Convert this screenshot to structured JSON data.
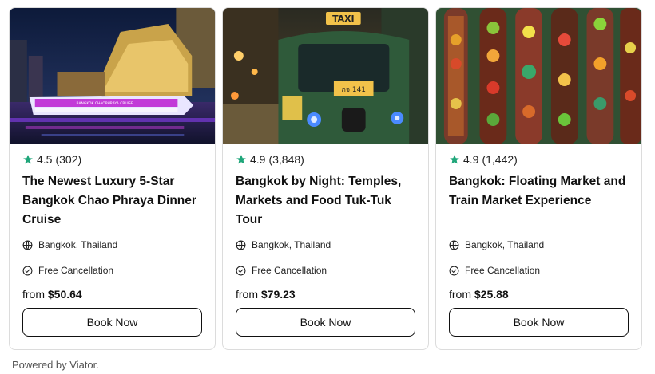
{
  "cards": [
    {
      "rating": "4.5",
      "reviews": "(302)",
      "title": "The Newest Luxury 5-Star Bangkok Chao Phraya Dinner Cruise",
      "location": "Bangkok, Thailand",
      "cancellation": "Free Cancellation",
      "price_prefix": "from",
      "price": "$50.64",
      "button_label": "Book Now",
      "photo_sign": "BANGKOK CHAOPHRAYA CRUISE"
    },
    {
      "rating": "4.9",
      "reviews": "(3,848)",
      "title": "Bangkok by Night: Temples, Markets and Food Tuk-Tuk Tour",
      "location": "Bangkok, Thailand",
      "cancellation": "Free Cancellation",
      "price_prefix": "from",
      "price": "$79.23",
      "button_label": "Book Now",
      "photo_sign": "TAXI",
      "photo_plate": "กจ 141"
    },
    {
      "rating": "4.9",
      "reviews": "(1,442)",
      "title": "Bangkok: Floating Market and Train Market Experience",
      "location": "Bangkok, Thailand",
      "cancellation": "Free Cancellation",
      "price_prefix": "from",
      "price": "$25.88",
      "button_label": "Book Now"
    }
  ],
  "footer": {
    "powered_by": "Powered by Viator."
  },
  "colors": {
    "star": "#1fa67a",
    "border": "#dcdcdc",
    "text": "#111111"
  },
  "icons": {
    "rating": "star-icon",
    "location": "globe-icon",
    "cancellation": "check-circle-icon"
  }
}
